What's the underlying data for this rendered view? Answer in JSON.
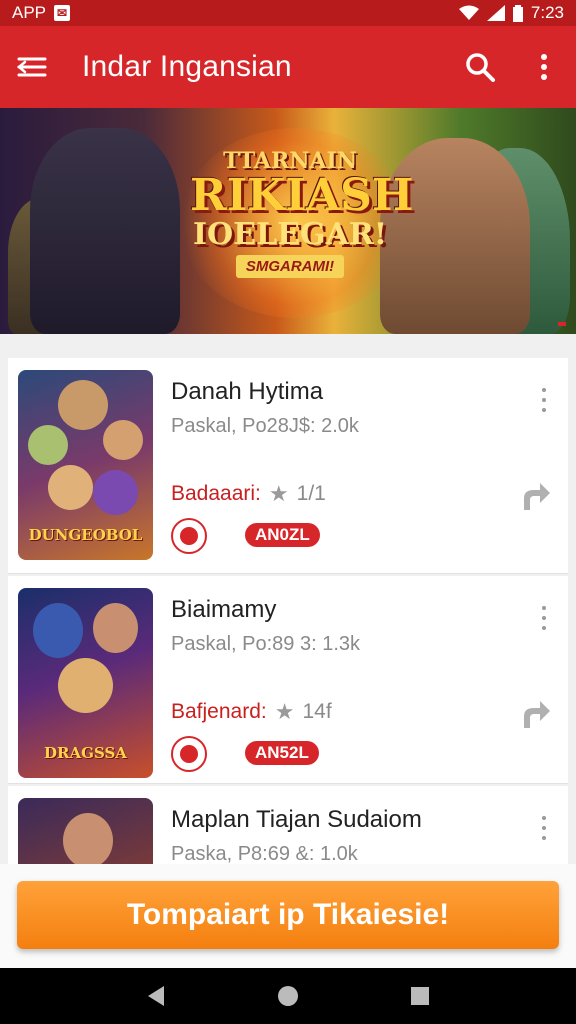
{
  "status_bar": {
    "app_label": "APP",
    "time": "7:23",
    "colors": {
      "bg": "#b81b1b"
    }
  },
  "app_bar": {
    "title": "Indar Ingansian",
    "accent": "#d7262a",
    "icons": [
      "menu-icon",
      "search-icon",
      "more-vert-icon"
    ]
  },
  "banner": {
    "title_line1": "TTARNAIN",
    "title_line2": "RIKIASH",
    "title_line3": "IOELEGAR!",
    "title_line4": "SMGARAMI!"
  },
  "games": [
    {
      "name": "Danah Hytima",
      "meta": "Paskal, Po28J$: 2.0k",
      "rating_label": "Badaaari:",
      "rating_value": "1/1",
      "tag": "AN0ZL",
      "thumb_title": "DUNGEOBOL",
      "icons": [
        "game-badge-icon",
        "share-icon",
        "more-vert-icon"
      ]
    },
    {
      "name": "Biaimamy",
      "meta": "Paskal, Po:89 3: 1.3k",
      "rating_label": "Bafjenard:",
      "rating_value": "14f",
      "tag": "AN52L",
      "thumb_title": "DRAGSSA",
      "icons": [
        "game-badge-icon",
        "share-icon",
        "more-vert-icon"
      ]
    },
    {
      "name": "Maplan Tiajan Sudaiom",
      "meta": "Paska, P8:69 &: 1.0k",
      "rating_label": "",
      "rating_value": "",
      "tag": "",
      "thumb_title": "",
      "icons": [
        "more-vert-icon"
      ]
    }
  ],
  "cta": {
    "label": "Tompaiart ip Tikaiesie!",
    "color": "#f47f0f"
  },
  "nav_bar": {
    "icons": [
      "back-icon",
      "home-icon",
      "recents-icon"
    ]
  }
}
